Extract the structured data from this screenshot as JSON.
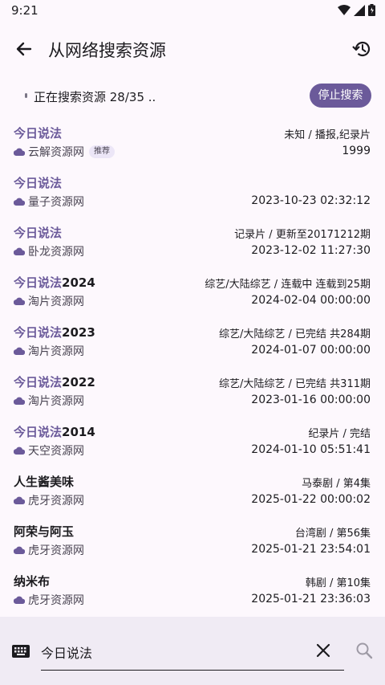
{
  "status_bar": {
    "time": "9:21"
  },
  "header": {
    "title": "从网络搜索资源"
  },
  "search_status": {
    "text": "正在搜索资源 28/35 ..",
    "stop_label": "停止搜索"
  },
  "results": [
    {
      "title_hl": "今日说法",
      "title_rest": "",
      "source": "云解资源网",
      "badge": "推荐",
      "meta": "未知 / 播报,纪录片",
      "time": "1999"
    },
    {
      "title_hl": "今日说法",
      "title_rest": "",
      "source": "量子资源网",
      "meta": "",
      "time": "2023-10-23 02:32:12"
    },
    {
      "title_hl": "今日说法",
      "title_rest": "",
      "source": "卧龙资源网",
      "meta": "记录片 / 更新至20171212期",
      "time": "2023-12-02 11:27:30"
    },
    {
      "title_hl": "今日说法",
      "title_rest": "2024",
      "source": "淘片资源网",
      "meta": "综艺/大陆综艺 / 连载中 连载到25期",
      "time": "2024-02-04 00:00:00"
    },
    {
      "title_hl": "今日说法",
      "title_rest": "2023",
      "source": "淘片资源网",
      "meta": "综艺/大陆综艺 / 已完结 共284期",
      "time": "2024-01-07 00:00:00"
    },
    {
      "title_hl": "今日说法",
      "title_rest": "2022",
      "source": "淘片资源网",
      "meta": "综艺/大陆综艺 / 已完结 共311期",
      "time": "2023-01-16 00:00:00"
    },
    {
      "title_hl": "今日说法",
      "title_rest": "2014",
      "source": "天空资源网",
      "meta": "纪录片 / 完结",
      "time": "2024-01-10 05:51:41"
    },
    {
      "title_hl": "",
      "title_rest": "人生酱美味",
      "source": "虎牙资源网",
      "meta": "马泰剧 / 第4集",
      "time": "2025-01-22 00:00:02"
    },
    {
      "title_hl": "",
      "title_rest": "阿荣与阿玉",
      "source": "虎牙资源网",
      "meta": "台湾剧 / 第56集",
      "time": "2025-01-21 23:54:01"
    },
    {
      "title_hl": "",
      "title_rest": "纳米布",
      "source": "虎牙资源网",
      "meta": "韩剧 / 第10集",
      "time": "2025-01-21 23:36:03"
    }
  ],
  "search": {
    "value": "今日说法"
  },
  "colors": {
    "accent": "#6b5a9a",
    "background": "#fdf8fd",
    "bottom_bar": "#f0ebf4"
  }
}
